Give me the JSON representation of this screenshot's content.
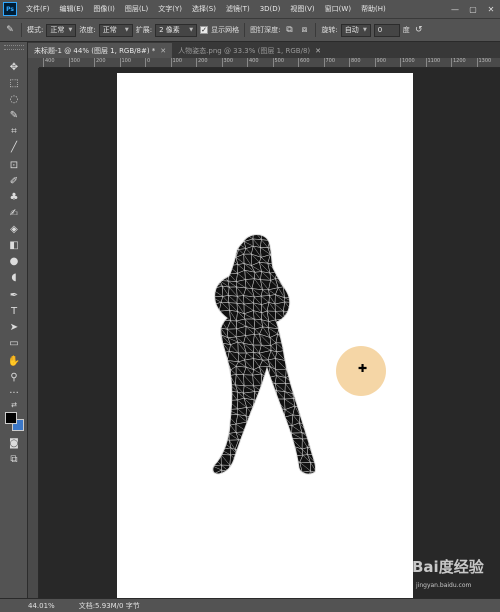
{
  "menubar": {
    "logo": "Ps",
    "items": [
      "文件(F)",
      "编辑(E)",
      "图像(I)",
      "图层(L)",
      "文字(Y)",
      "选择(S)",
      "滤镜(T)",
      "3D(D)",
      "视图(V)",
      "窗口(W)",
      "帮助(H)"
    ],
    "window_controls": [
      "—",
      "▢",
      "✕"
    ]
  },
  "options": {
    "mode_label": "模式:",
    "mode_value": "正常",
    "density_label": "浓度:",
    "density_value": "正常",
    "expand_label": "扩展:",
    "expand_value": "2 像素",
    "show_mesh_label": "显示网格",
    "show_mesh_checked": true,
    "pin_depth_label": "图钉深度:",
    "rotate_label": "旋转:",
    "rotate_value": "自动",
    "angle_value": "0",
    "angle_unit": "度"
  },
  "tabs": [
    {
      "label": "未标题-1 @ 44% (图层 1, RGB/8#) *",
      "active": true
    },
    {
      "label": "人物姿态.png @ 33.3% (图层 1, RGB/8)",
      "active": false
    }
  ],
  "ruler": {
    "labels": [
      "400",
      "300",
      "200",
      "100",
      "0",
      "100",
      "200",
      "300",
      "400",
      "500",
      "600",
      "700",
      "800",
      "900",
      "1000",
      "1100",
      "1200",
      "1300"
    ]
  },
  "status": {
    "zoom": "44.01%",
    "doc_info": "文档:5.93M/0 字节"
  },
  "watermark": {
    "logo_text": "Bai度经验",
    "url": "jingyan.baidu.com"
  },
  "colors": {
    "foreground": "#000000",
    "background": "#3c78c8",
    "glow": "#f5d6a6"
  },
  "icons": [
    "move-icon",
    "marquee-icon",
    "lasso-icon",
    "quick-select-icon",
    "crop-icon",
    "eyedropper-icon",
    "spot-heal-icon",
    "brush-icon",
    "clone-stamp-icon",
    "history-brush-icon",
    "eraser-icon",
    "gradient-icon",
    "blur-icon",
    "dodge-icon",
    "pen-icon",
    "type-icon",
    "path-select-icon",
    "rectangle-icon",
    "hand-icon",
    "zoom-icon"
  ]
}
